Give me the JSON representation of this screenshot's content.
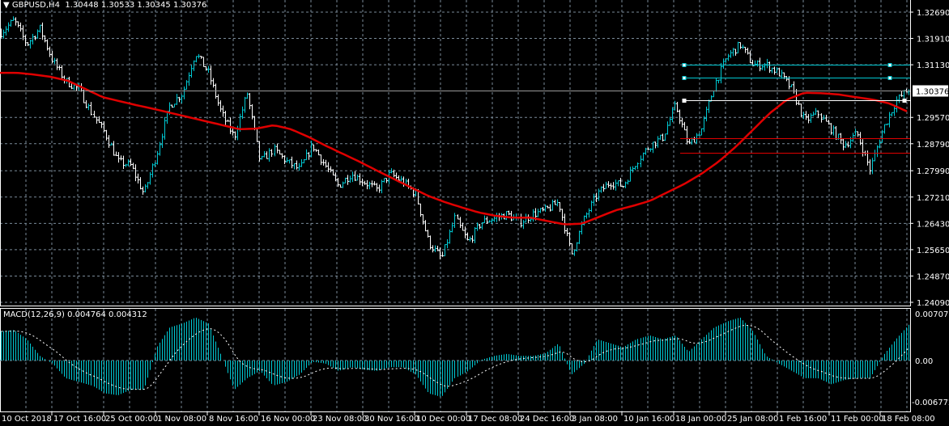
{
  "header": {
    "symbol": "GBPUSD,H4",
    "open": "1.30448",
    "high": "1.30533",
    "low": "1.30345",
    "close": "1.30376"
  },
  "macd_header": {
    "label": "MACD(12,26,9)",
    "macd": "0.004764",
    "signal": "0.004312"
  },
  "colors": {
    "up": "#00c8d2",
    "down": "#ffffff",
    "ma": "#e00000",
    "grid": "#7a8a99",
    "macd": "#00c8d2",
    "signal": "#ffffff"
  },
  "chart_data": {
    "type": "line",
    "title": "GBPUSD,H4",
    "price_ticks": [
      "1.32690",
      "1.31910",
      "1.31130",
      "1.30376",
      "1.29570",
      "1.28790",
      "1.27990",
      "1.27210",
      "1.26430",
      "1.25650",
      "1.24870",
      "1.24090"
    ],
    "current_price": "1.30376",
    "ylim": [
      1.2409,
      1.3269
    ],
    "macd_ticks": [
      "0.007071",
      "0.00",
      "-0.006772"
    ],
    "macd_ylim": [
      -0.006772,
      0.007071
    ],
    "time_labels": [
      "10 Oct 2018",
      "17 Oct 16:00",
      "25 Oct 00:00",
      "1 Nov 08:00",
      "8 Nov 16:00",
      "16 Nov 00:00",
      "23 Nov 08:00",
      "30 Nov 16:00",
      "10 Dec 00:00",
      "17 Dec 08:00",
      "24 Dec 16:00",
      "3 Jan 08:00",
      "10 Jan 16:00",
      "18 Jan 00:00",
      "25 Jan 08:00",
      "1 Feb 16:00",
      "11 Feb 00:00",
      "18 Feb 08:00"
    ],
    "close_keypoints": [
      1.3209,
      1.3245,
      1.3173,
      1.3221,
      1.3125,
      1.3065,
      1.3041,
      1.297,
      1.291,
      1.2826,
      1.2814,
      1.273,
      1.285,
      1.2993,
      1.3029,
      1.3149,
      1.3089,
      1.297,
      1.2898,
      1.3029,
      1.2826,
      1.2862,
      1.2826,
      1.2802,
      1.2874,
      1.2814,
      1.2754,
      1.279,
      1.2766,
      1.2742,
      1.279,
      1.2766,
      1.273,
      1.2586,
      1.2538,
      1.2658,
      1.2586,
      1.2646,
      1.2658,
      1.267,
      1.2646,
      1.267,
      1.2682,
      1.2706,
      1.255,
      1.2658,
      1.273,
      1.2766,
      1.2754,
      1.2826,
      1.2874,
      1.2898,
      1.2993,
      1.2874,
      1.2922,
      1.3053,
      1.3137,
      1.3173,
      1.3113,
      1.3113,
      1.3089,
      1.3041,
      1.2946,
      1.297,
      1.2922,
      1.2874,
      1.291,
      1.2802,
      1.2922,
      1.3005,
      1.3041
    ],
    "ma_keypoints": [
      1.3089,
      1.3089,
      1.3084,
      1.3077,
      1.3065,
      1.3041,
      1.3017,
      1.3005,
      1.2993,
      1.2982,
      1.297,
      1.2958,
      1.2946,
      1.2934,
      1.2922,
      1.2924,
      1.2934,
      1.2922,
      1.29,
      1.2874,
      1.285,
      1.2826,
      1.28,
      1.2775,
      1.275,
      1.2725,
      1.2706,
      1.269,
      1.2675,
      1.2665,
      1.266,
      1.266,
      1.265,
      1.264,
      1.2642,
      1.2662,
      1.2682,
      1.2695,
      1.271,
      1.2735,
      1.276,
      1.279,
      1.2826,
      1.287,
      1.292,
      1.297,
      1.301,
      1.303,
      1.3029,
      1.3025,
      1.3017,
      1.301,
      1.2998,
      1.2975
    ],
    "macd_keypoints": [
      0.0044,
      0.0046,
      0.0032,
      0.0007,
      -0.0005,
      -0.0029,
      -0.0035,
      -0.0041,
      -0.0054,
      -0.0057,
      -0.0048,
      -0.0048,
      0.002,
      0.005,
      0.0056,
      0.0065,
      0.0056,
      0.0007,
      -0.0048,
      -0.0029,
      -0.0017,
      -0.0041,
      -0.0035,
      -0.0023,
      -0.0002,
      -0.0005,
      -0.0017,
      -0.0011,
      -0.0015,
      -0.0017,
      -0.0011,
      -0.0011,
      -0.0023,
      -0.0054,
      -0.006,
      -0.0029,
      -0.0017,
      0.0001,
      0.0007,
      0.001,
      0.0007,
      0.0007,
      0.0011,
      0.0026,
      -0.0023,
      -0.0005,
      0.0032,
      0.0026,
      0.002,
      0.0032,
      0.0038,
      0.0032,
      0.0038,
      0.0013,
      0.0032,
      0.005,
      0.0059,
      0.0065,
      0.0044,
      0.0007,
      -0.0005,
      -0.0017,
      -0.0029,
      -0.0029,
      -0.0039,
      -0.0032,
      -0.0029,
      -0.0029,
      0.0007,
      0.0032,
      0.0054
    ],
    "levels": [
      {
        "name": "cyan-level-1",
        "price": 1.3113,
        "color": "#00c8d2"
      },
      {
        "name": "cyan-level-2",
        "price": 1.3075,
        "color": "#00c8d2"
      },
      {
        "name": "white-level",
        "price": 1.3007,
        "color": "#ffffff"
      },
      {
        "name": "red-level-1",
        "price": 1.2895,
        "color": "#e00000"
      },
      {
        "name": "red-level-2",
        "price": 1.2853,
        "color": "#e00000"
      }
    ]
  }
}
